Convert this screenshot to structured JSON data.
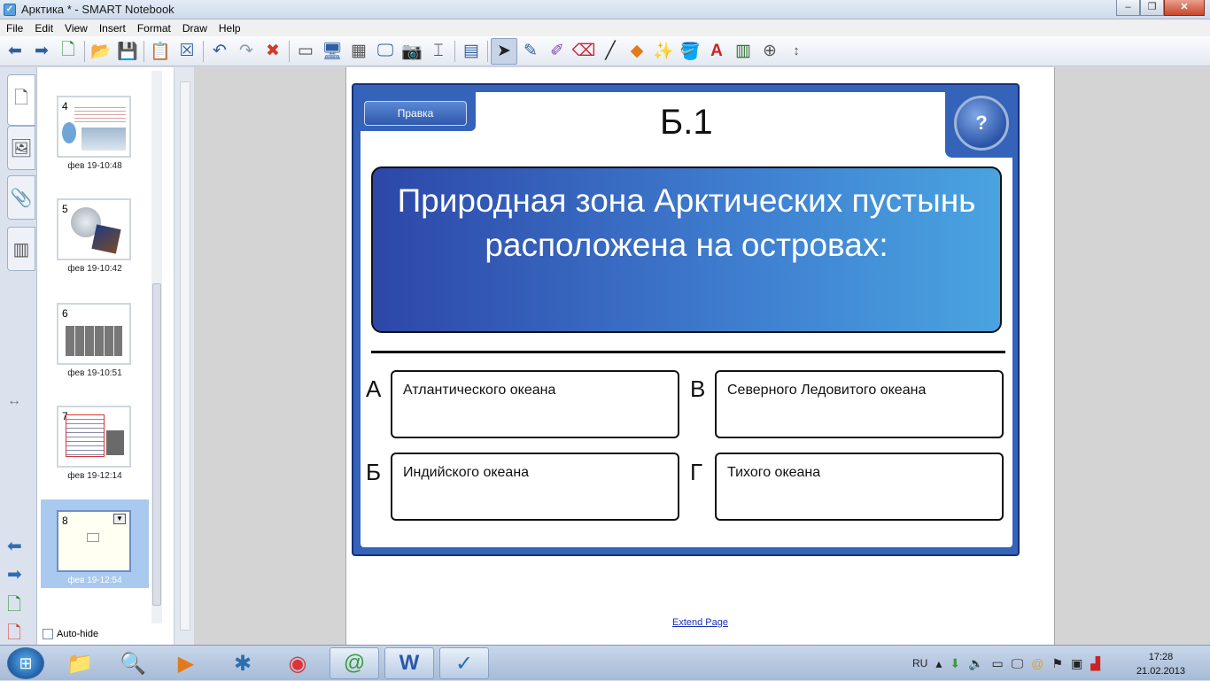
{
  "window": {
    "title": "Арктика * - SMART Notebook",
    "app_icon": "smart-notebook-icon"
  },
  "menu": [
    "File",
    "Edit",
    "View",
    "Insert",
    "Format",
    "Draw",
    "Help"
  ],
  "toolbar": [
    "back-arrow-icon",
    "forward-arrow-icon",
    "add-page-icon",
    "open-folder-icon",
    "save-icon",
    "paste-icon",
    "delete-page-icon",
    "undo-icon",
    "redo-icon",
    "delete-icon",
    "screen-shade-icon",
    "full-screen-icon",
    "transparent-bg-icon",
    "dual-page-icon",
    "screen-capture-icon",
    "document-camera-icon",
    "table-icon",
    "select-icon",
    "pen-icon",
    "creative-pen-icon",
    "eraser-icon",
    "line-icon",
    "shapes-icon",
    "magic-pen-icon",
    "fill-icon",
    "text-icon",
    "properties-icon",
    "measure-icon",
    "move-toolbar-icon"
  ],
  "sorter": {
    "pages": [
      {
        "num": "4",
        "time": "фев 19-10:48"
      },
      {
        "num": "5",
        "time": "фев 19-10:42"
      },
      {
        "num": "6",
        "time": "фев 19-10:51"
      },
      {
        "num": "7",
        "time": "фев 19-12:14"
      },
      {
        "num": "8",
        "time": "фев 19-12:54"
      }
    ],
    "autohide_label": "Auto-hide"
  },
  "slide": {
    "pravka_label": "Правка",
    "help_label": "?",
    "title": "Б.1",
    "question": "Природная зона Арктических пустынь расположена на островах:",
    "answers": [
      {
        "letter": "А",
        "text": "Атлантического океана"
      },
      {
        "letter": "В",
        "text": "Северного Ледовитого океана"
      },
      {
        "letter": "Б",
        "text": "Индийского океана"
      },
      {
        "letter": "Г",
        "text": "Тихого океана"
      }
    ]
  },
  "extend_page": "Extend Page",
  "taskbar": {
    "lang": "RU",
    "time": "17:28",
    "date": "21.02.2013"
  },
  "colors": {
    "slide_blue": "#3463b9",
    "question_dark": "#2d47a8",
    "question_light": "#49a4e0"
  }
}
